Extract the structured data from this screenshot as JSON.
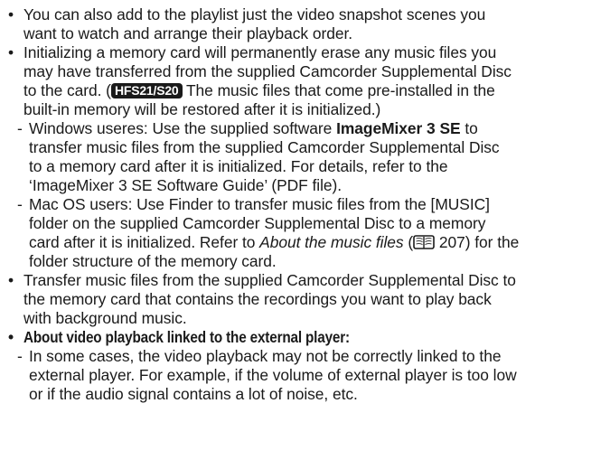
{
  "bullets": {
    "b1": {
      "l1": "You can also add to the playlist just the video snapshot scenes you",
      "l2": "want to watch and arrange their playback order."
    },
    "b2": {
      "l1": "Initializing a memory card will permanently erase any music files you",
      "l2": "may have transferred from the supplied Camcorder Supplemental Disc",
      "l3_pre": "to the card. (",
      "badge": "HFS21/S20",
      "l3_post": " The music files that come pre-installed in the",
      "l4": "built-in memory will be restored after it is initialized.)"
    },
    "s1": {
      "l1_pre": "Windows useres: Use the supplied software ",
      "l1_bold": "ImageMixer 3 SE",
      "l1_post": " to",
      "l2": "transfer music files from the supplied Camcorder Supplemental Disc",
      "l3": "to a memory card after it is initialized. For details, refer to the",
      "l4": "‘ImageMixer 3 SE Software Guide’ (PDF file)."
    },
    "s2": {
      "l1": "Mac OS users: Use Finder to transfer music files from the [MUSIC]",
      "l2": "folder on the supplied Camcorder Supplemental Disc to a memory",
      "l3_pre": "card after it is initialized. Refer to ",
      "l3_italic": "About the music files",
      "l3_open": " (",
      "l3_page": " 207) for the",
      "l4": "folder structure of the memory card."
    },
    "b3": {
      "l1": "Transfer music files from the supplied Camcorder Supplemental Disc to",
      "l2": "the memory card that contains the recordings you want to play back",
      "l3": "with background music."
    },
    "b4": {
      "heading": "About video playback linked to the external player:"
    },
    "s3": {
      "l1": "In some cases, the video playback may not be correctly linked to the",
      "l2": "external player. For example, if the volume of external player is too low",
      "l3": "or if the audio signal contains a lot of noise, etc."
    }
  },
  "symbols": {
    "bullet": "•",
    "dash": "-"
  },
  "icons": {
    "reference": "book-reference-icon"
  },
  "colors": {
    "text": "#1a1a1a",
    "badge_bg": "#1a1a1a",
    "badge_fg": "#ffffff"
  }
}
